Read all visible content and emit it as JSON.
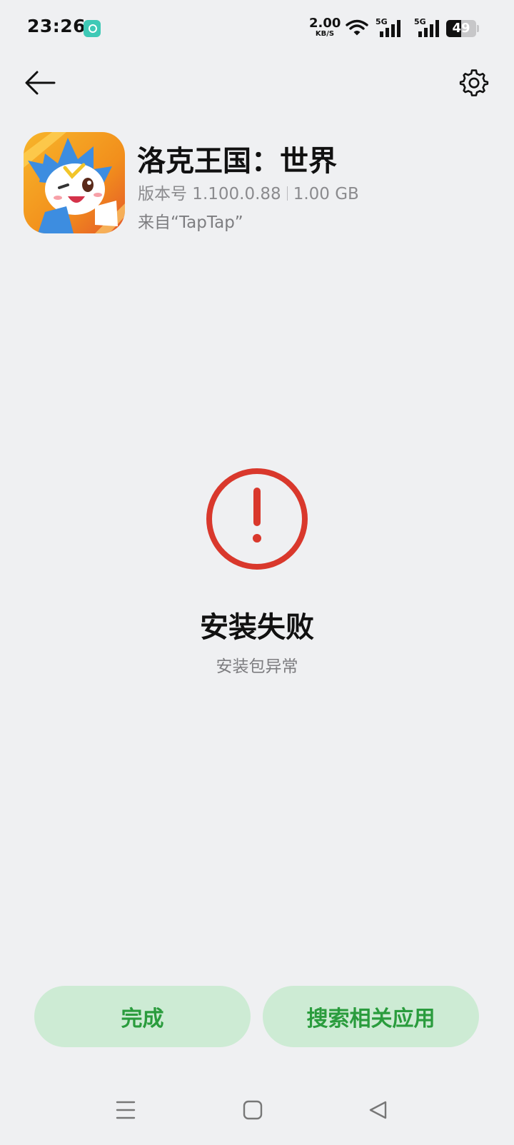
{
  "status_bar": {
    "time": "23:26",
    "net_speed_value": "2.00",
    "net_speed_unit": "KB/S",
    "signal_1_label": "5G",
    "signal_2_label": "5G",
    "battery_level": "49"
  },
  "header": {
    "back_icon": "arrow-left-icon",
    "settings_icon": "gear-icon"
  },
  "app": {
    "name": "洛克王国：世界",
    "version": "版本号 1.100.0.88",
    "size": "1.00 GB",
    "source": "来自“TapTap”",
    "icon_colors": {
      "background": "#f2a01e",
      "character": "#3d8de0"
    }
  },
  "result": {
    "icon": "error-circle-icon",
    "title": "安装失败",
    "subtitle": "安装包异常",
    "icon_color": "#d9382c"
  },
  "buttons": {
    "done_label": "完成",
    "search_label": "搜索相关应用",
    "accent_color": "#2a9c3d",
    "button_bg": "#cdebd4"
  },
  "nav_bar": {
    "menu_icon": "menu-icon",
    "home_icon": "home-square-icon",
    "back_icon": "back-triangle-icon"
  }
}
